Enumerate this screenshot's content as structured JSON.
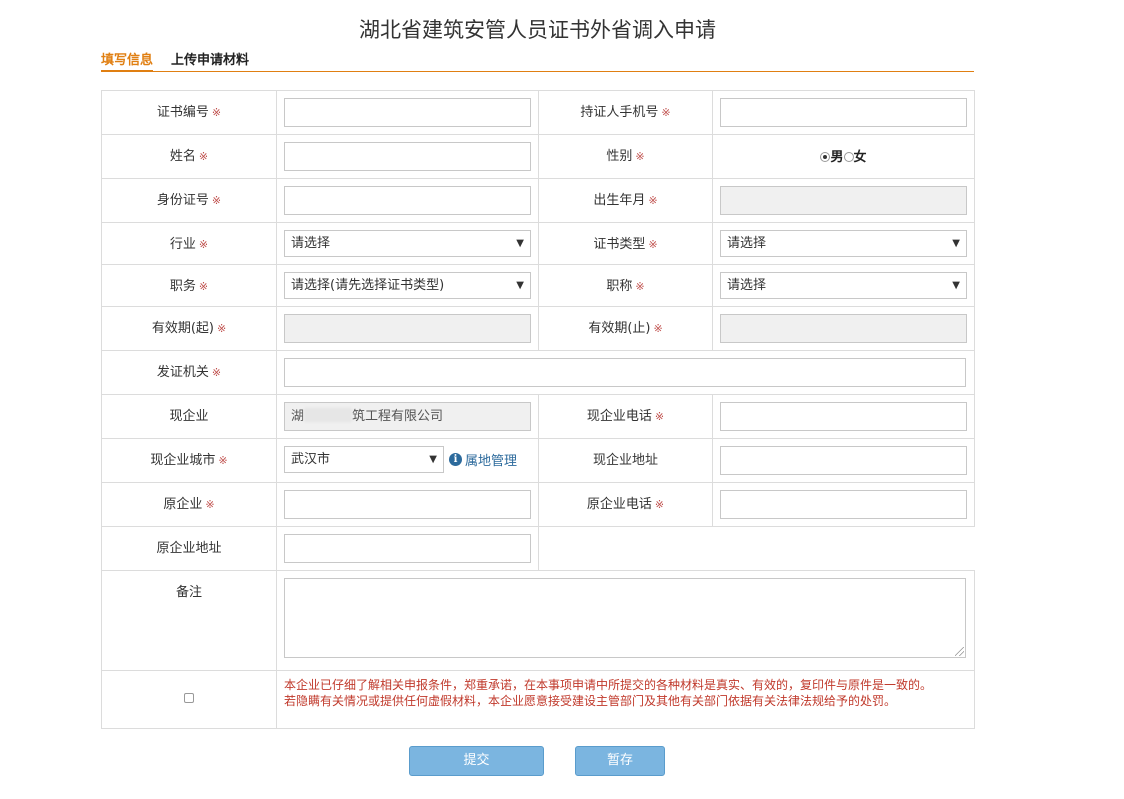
{
  "page": {
    "title": "湖北省建筑安管人员证书外省调入申请"
  },
  "tabs": [
    {
      "label": "填写信息",
      "active": true
    },
    {
      "label": "上传申请材料",
      "active": false
    }
  ],
  "form": {
    "cert_no_label": "证书编号",
    "phone_label": "持证人手机号",
    "name_label": "姓名",
    "gender_label": "性别",
    "gender_options": [
      "男",
      "女"
    ],
    "gender_selected": "男",
    "id_label": "身份证号",
    "birth_label": "出生年月",
    "industry_label": "行业",
    "industry_value": "请选择",
    "cert_type_label": "证书类型",
    "cert_type_value": "请选择",
    "position_label": "职务",
    "position_value": "请选择(请先选择证书类型)",
    "title_label": "职称",
    "title_value": "请选择",
    "valid_from_label": "有效期(起)",
    "valid_to_label": "有效期(止)",
    "issuer_label": "发证机关",
    "cur_company_label": "现企业",
    "cur_company_prefix": "湖",
    "cur_company_suffix": "筑工程有限公司",
    "cur_phone_label": "现企业电话",
    "cur_city_label": "现企业城市",
    "cur_city_value": "武汉市",
    "territory_link": "属地管理",
    "cur_address_label": "现企业地址",
    "prev_company_label": "原企业",
    "prev_phone_label": "原企业电话",
    "prev_address_label": "原企业地址",
    "remark_label": "备注",
    "commitment_line1": "本企业已仔细了解相关申报条件，郑重承诺，在本事项申请中所提交的各种材料是真实、有效的，复印件与原件是一致的。",
    "commitment_line2": "若隐瞒有关情况或提供任何虚假材料，本企业愿意接受建设主管部门及其他有关部门依据有关法律法规给予的处罚。",
    "required_mark": "※"
  },
  "buttons": {
    "submit": "提交",
    "save": "暂存"
  },
  "colors": {
    "accent_orange": "#e07f12",
    "required_red": "#c0504d",
    "button_blue": "#7bb5e0",
    "link_blue": "#2c6a9c"
  }
}
